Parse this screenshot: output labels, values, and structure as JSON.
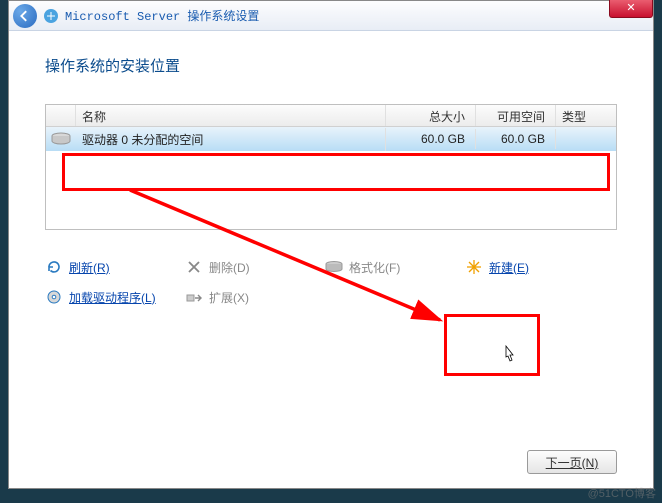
{
  "window": {
    "title": "Microsoft Server 操作系统设置",
    "close": "✕"
  },
  "heading": "操作系统的安装位置",
  "table": {
    "headers": {
      "name": "名称",
      "total": "总大小",
      "free": "可用空间",
      "type": "类型"
    },
    "rows": [
      {
        "name": "驱动器 0 未分配的空间",
        "total": "60.0 GB",
        "free": "60.0 GB",
        "type": ""
      }
    ]
  },
  "actions": {
    "refresh": "刷新(R)",
    "delete": "删除(D)",
    "format": "格式化(F)",
    "new": "新建(E)",
    "load_driver": "加载驱动程序(L)",
    "extend": "扩展(X)"
  },
  "next_button": "下一页(N)",
  "watermark": "@51CTO博客"
}
